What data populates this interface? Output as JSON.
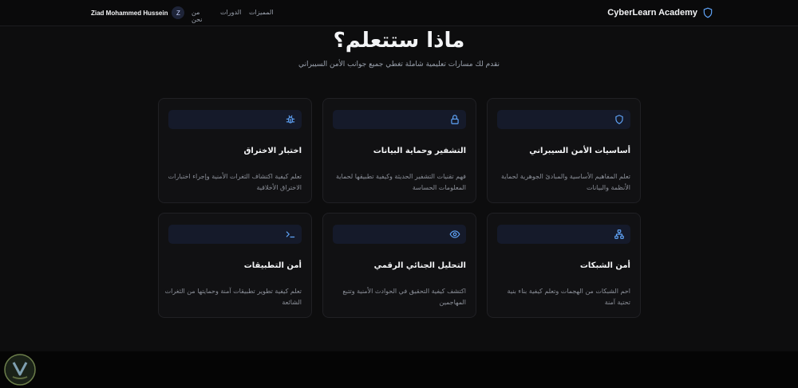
{
  "header": {
    "brand": "CyberLearn Academy",
    "user_name": "Ziad Mohammed Hussein",
    "avatar_initial": "Z",
    "nav": [
      "من نحن",
      "الدورات",
      "المميزات"
    ]
  },
  "hero": {
    "title": "ماذا ستتعلم؟",
    "subtitle": "نقدم لك مسارات تعليمية شاملة تغطي جميع جوانب الأمن السيبراني"
  },
  "cards": [
    {
      "icon": "shield-icon",
      "title": "أساسيات الأمن السيبراني",
      "description": "تعلم المفاهيم الأساسية والمبادئ الجوهرية لحماية الأنظمة والبيانات"
    },
    {
      "icon": "lock-icon",
      "title": "التشفير وحماية البيانات",
      "description": "فهم تقنيات التشفير الحديثة وكيفية تطبيقها لحماية المعلومات الحساسة"
    },
    {
      "icon": "bug-icon",
      "title": "اختبار الاختراق",
      "description": "تعلم كيفية اكتشاف الثغرات الأمنية وإجراء اختبارات الاختراق الأخلاقية"
    },
    {
      "icon": "network-icon",
      "title": "أمن الشبكات",
      "description": "احم الشبكات من الهجمات وتعلم كيفية بناء بنية تحتية آمنة"
    },
    {
      "icon": "eye-icon",
      "title": "التحليل الجنائي الرقمي",
      "description": "اكتشف كيفية التحقيق في الحوادث الأمنية وتتبع المهاجمين"
    },
    {
      "icon": "terminal-icon",
      "title": "أمن التطبيقات",
      "description": "تعلم كيفية تطوير تطبيقات آمنة وحمايتها من الثغرات الشائعة"
    }
  ],
  "colors": {
    "background": "#0d0d0e",
    "card": "#111113",
    "accent": "#60a5fa",
    "icon_bg": "#151a2a"
  }
}
